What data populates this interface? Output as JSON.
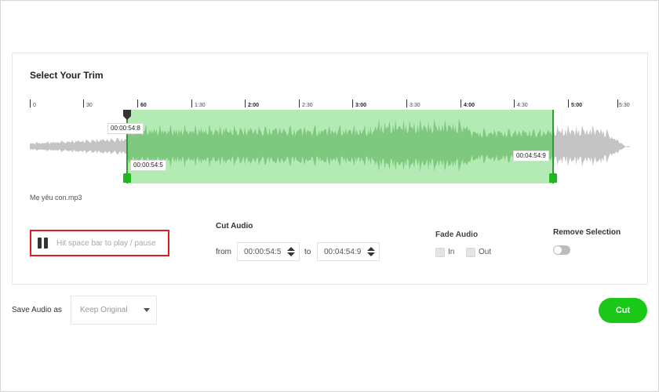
{
  "trim": {
    "title": "Select Your Trim",
    "ruler_labels": [
      "0",
      "30",
      "60",
      "1:30",
      "2:00",
      "2:30",
      "3:00",
      "3:30",
      "4:00",
      "4:30",
      "5:00",
      "5:30"
    ],
    "start_marker": "00:00:54:8",
    "start_bottom": "00:00:54:5",
    "end_marker": "00:04:54:9",
    "filename": "Mẹ yêu con.mp3",
    "colors": {
      "selection": "#b4ebb4",
      "handle": "#1fb81f",
      "wave_gray": "#c4c4c4",
      "wave_green": "#7fc87f"
    }
  },
  "player": {
    "pause_icon": "pause-icon",
    "hint": "Hit space bar to play / pause"
  },
  "cut_audio": {
    "title": "Cut Audio",
    "from_label": "from",
    "from_value": "00:00:54:5",
    "to_label": "to",
    "to_value": "00:04:54:9"
  },
  "fade_audio": {
    "title": "Fade Audio",
    "in_label": "In",
    "out_label": "Out",
    "in_checked": false,
    "out_checked": false
  },
  "remove_selection": {
    "title": "Remove Selection",
    "enabled": false
  },
  "save": {
    "label": "Save Audio as",
    "format_value": "Keep Original"
  },
  "cut_button": {
    "label": "Cut",
    "color": "#19c819"
  }
}
